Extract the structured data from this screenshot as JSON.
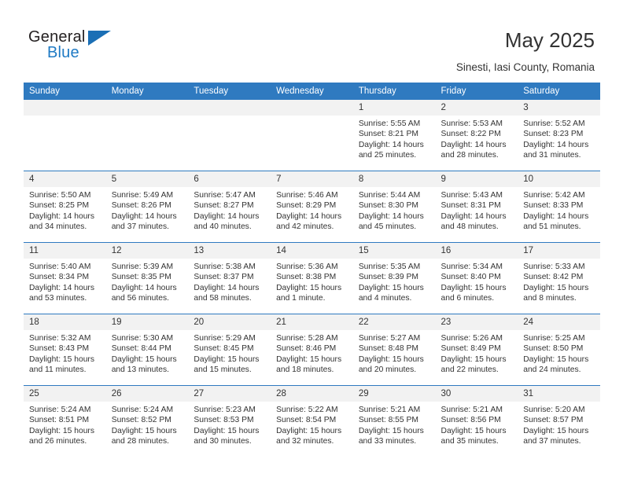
{
  "brand": {
    "name_top": "General",
    "name_bottom": "Blue",
    "accent_color": "#1b6fb5",
    "triangle_icon": "triangle-icon"
  },
  "header": {
    "title": "May 2025",
    "subtitle": "Sinesti, Iasi County, Romania"
  },
  "calendar": {
    "header_bg": "#2f7ac0",
    "daycell_bg": "#f2f2f2",
    "weekdays": [
      "Sunday",
      "Monday",
      "Tuesday",
      "Wednesday",
      "Thursday",
      "Friday",
      "Saturday"
    ],
    "weeks": [
      [
        {
          "day": "",
          "empty": true,
          "sunrise": "",
          "sunset": "",
          "daylight1": "",
          "daylight2": ""
        },
        {
          "day": "",
          "empty": true,
          "sunrise": "",
          "sunset": "",
          "daylight1": "",
          "daylight2": ""
        },
        {
          "day": "",
          "empty": true,
          "sunrise": "",
          "sunset": "",
          "daylight1": "",
          "daylight2": ""
        },
        {
          "day": "",
          "empty": true,
          "sunrise": "",
          "sunset": "",
          "daylight1": "",
          "daylight2": ""
        },
        {
          "day": "1",
          "empty": false,
          "sunrise": "Sunrise: 5:55 AM",
          "sunset": "Sunset: 8:21 PM",
          "daylight1": "Daylight: 14 hours",
          "daylight2": "and 25 minutes."
        },
        {
          "day": "2",
          "empty": false,
          "sunrise": "Sunrise: 5:53 AM",
          "sunset": "Sunset: 8:22 PM",
          "daylight1": "Daylight: 14 hours",
          "daylight2": "and 28 minutes."
        },
        {
          "day": "3",
          "empty": false,
          "sunrise": "Sunrise: 5:52 AM",
          "sunset": "Sunset: 8:23 PM",
          "daylight1": "Daylight: 14 hours",
          "daylight2": "and 31 minutes."
        }
      ],
      [
        {
          "day": "4",
          "empty": false,
          "sunrise": "Sunrise: 5:50 AM",
          "sunset": "Sunset: 8:25 PM",
          "daylight1": "Daylight: 14 hours",
          "daylight2": "and 34 minutes."
        },
        {
          "day": "5",
          "empty": false,
          "sunrise": "Sunrise: 5:49 AM",
          "sunset": "Sunset: 8:26 PM",
          "daylight1": "Daylight: 14 hours",
          "daylight2": "and 37 minutes."
        },
        {
          "day": "6",
          "empty": false,
          "sunrise": "Sunrise: 5:47 AM",
          "sunset": "Sunset: 8:27 PM",
          "daylight1": "Daylight: 14 hours",
          "daylight2": "and 40 minutes."
        },
        {
          "day": "7",
          "empty": false,
          "sunrise": "Sunrise: 5:46 AM",
          "sunset": "Sunset: 8:29 PM",
          "daylight1": "Daylight: 14 hours",
          "daylight2": "and 42 minutes."
        },
        {
          "day": "8",
          "empty": false,
          "sunrise": "Sunrise: 5:44 AM",
          "sunset": "Sunset: 8:30 PM",
          "daylight1": "Daylight: 14 hours",
          "daylight2": "and 45 minutes."
        },
        {
          "day": "9",
          "empty": false,
          "sunrise": "Sunrise: 5:43 AM",
          "sunset": "Sunset: 8:31 PM",
          "daylight1": "Daylight: 14 hours",
          "daylight2": "and 48 minutes."
        },
        {
          "day": "10",
          "empty": false,
          "sunrise": "Sunrise: 5:42 AM",
          "sunset": "Sunset: 8:33 PM",
          "daylight1": "Daylight: 14 hours",
          "daylight2": "and 51 minutes."
        }
      ],
      [
        {
          "day": "11",
          "empty": false,
          "sunrise": "Sunrise: 5:40 AM",
          "sunset": "Sunset: 8:34 PM",
          "daylight1": "Daylight: 14 hours",
          "daylight2": "and 53 minutes."
        },
        {
          "day": "12",
          "empty": false,
          "sunrise": "Sunrise: 5:39 AM",
          "sunset": "Sunset: 8:35 PM",
          "daylight1": "Daylight: 14 hours",
          "daylight2": "and 56 minutes."
        },
        {
          "day": "13",
          "empty": false,
          "sunrise": "Sunrise: 5:38 AM",
          "sunset": "Sunset: 8:37 PM",
          "daylight1": "Daylight: 14 hours",
          "daylight2": "and 58 minutes."
        },
        {
          "day": "14",
          "empty": false,
          "sunrise": "Sunrise: 5:36 AM",
          "sunset": "Sunset: 8:38 PM",
          "daylight1": "Daylight: 15 hours",
          "daylight2": "and 1 minute."
        },
        {
          "day": "15",
          "empty": false,
          "sunrise": "Sunrise: 5:35 AM",
          "sunset": "Sunset: 8:39 PM",
          "daylight1": "Daylight: 15 hours",
          "daylight2": "and 4 minutes."
        },
        {
          "day": "16",
          "empty": false,
          "sunrise": "Sunrise: 5:34 AM",
          "sunset": "Sunset: 8:40 PM",
          "daylight1": "Daylight: 15 hours",
          "daylight2": "and 6 minutes."
        },
        {
          "day": "17",
          "empty": false,
          "sunrise": "Sunrise: 5:33 AM",
          "sunset": "Sunset: 8:42 PM",
          "daylight1": "Daylight: 15 hours",
          "daylight2": "and 8 minutes."
        }
      ],
      [
        {
          "day": "18",
          "empty": false,
          "sunrise": "Sunrise: 5:32 AM",
          "sunset": "Sunset: 8:43 PM",
          "daylight1": "Daylight: 15 hours",
          "daylight2": "and 11 minutes."
        },
        {
          "day": "19",
          "empty": false,
          "sunrise": "Sunrise: 5:30 AM",
          "sunset": "Sunset: 8:44 PM",
          "daylight1": "Daylight: 15 hours",
          "daylight2": "and 13 minutes."
        },
        {
          "day": "20",
          "empty": false,
          "sunrise": "Sunrise: 5:29 AM",
          "sunset": "Sunset: 8:45 PM",
          "daylight1": "Daylight: 15 hours",
          "daylight2": "and 15 minutes."
        },
        {
          "day": "21",
          "empty": false,
          "sunrise": "Sunrise: 5:28 AM",
          "sunset": "Sunset: 8:46 PM",
          "daylight1": "Daylight: 15 hours",
          "daylight2": "and 18 minutes."
        },
        {
          "day": "22",
          "empty": false,
          "sunrise": "Sunrise: 5:27 AM",
          "sunset": "Sunset: 8:48 PM",
          "daylight1": "Daylight: 15 hours",
          "daylight2": "and 20 minutes."
        },
        {
          "day": "23",
          "empty": false,
          "sunrise": "Sunrise: 5:26 AM",
          "sunset": "Sunset: 8:49 PM",
          "daylight1": "Daylight: 15 hours",
          "daylight2": "and 22 minutes."
        },
        {
          "day": "24",
          "empty": false,
          "sunrise": "Sunrise: 5:25 AM",
          "sunset": "Sunset: 8:50 PM",
          "daylight1": "Daylight: 15 hours",
          "daylight2": "and 24 minutes."
        }
      ],
      [
        {
          "day": "25",
          "empty": false,
          "sunrise": "Sunrise: 5:24 AM",
          "sunset": "Sunset: 8:51 PM",
          "daylight1": "Daylight: 15 hours",
          "daylight2": "and 26 minutes."
        },
        {
          "day": "26",
          "empty": false,
          "sunrise": "Sunrise: 5:24 AM",
          "sunset": "Sunset: 8:52 PM",
          "daylight1": "Daylight: 15 hours",
          "daylight2": "and 28 minutes."
        },
        {
          "day": "27",
          "empty": false,
          "sunrise": "Sunrise: 5:23 AM",
          "sunset": "Sunset: 8:53 PM",
          "daylight1": "Daylight: 15 hours",
          "daylight2": "and 30 minutes."
        },
        {
          "day": "28",
          "empty": false,
          "sunrise": "Sunrise: 5:22 AM",
          "sunset": "Sunset: 8:54 PM",
          "daylight1": "Daylight: 15 hours",
          "daylight2": "and 32 minutes."
        },
        {
          "day": "29",
          "empty": false,
          "sunrise": "Sunrise: 5:21 AM",
          "sunset": "Sunset: 8:55 PM",
          "daylight1": "Daylight: 15 hours",
          "daylight2": "and 33 minutes."
        },
        {
          "day": "30",
          "empty": false,
          "sunrise": "Sunrise: 5:21 AM",
          "sunset": "Sunset: 8:56 PM",
          "daylight1": "Daylight: 15 hours",
          "daylight2": "and 35 minutes."
        },
        {
          "day": "31",
          "empty": false,
          "sunrise": "Sunrise: 5:20 AM",
          "sunset": "Sunset: 8:57 PM",
          "daylight1": "Daylight: 15 hours",
          "daylight2": "and 37 minutes."
        }
      ]
    ]
  }
}
